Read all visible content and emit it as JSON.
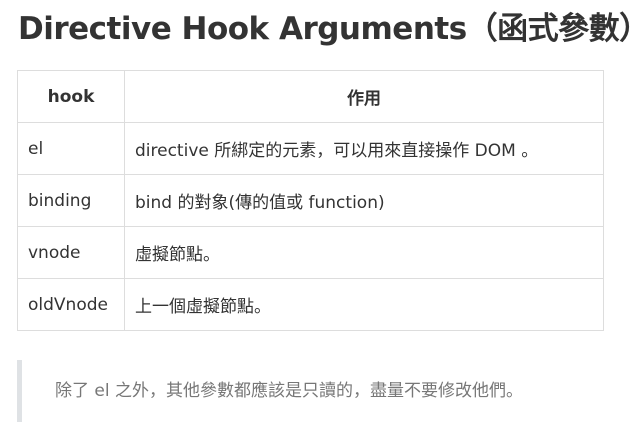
{
  "heading": {
    "title": "Directive Hook Arguments（函式參數）"
  },
  "table": {
    "headers": [
      "hook",
      "作用"
    ],
    "rows": [
      [
        "el",
        "directive 所綁定的元素，可以用來直接操作 DOM 。"
      ],
      [
        "binding",
        "bind 的對象(傳的值或 function)"
      ],
      [
        "vnode",
        "虛擬節點。"
      ],
      [
        "oldVnode",
        "上一個虛擬節點。"
      ]
    ]
  },
  "note": {
    "text": "除了 el 之外，其他參數都應該是只讀的，盡量不要修改他們。"
  },
  "colors": {
    "text": "#333333",
    "border": "#dddddd",
    "blockquote_border": "#dfe2e5",
    "blockquote_text": "#777777"
  }
}
